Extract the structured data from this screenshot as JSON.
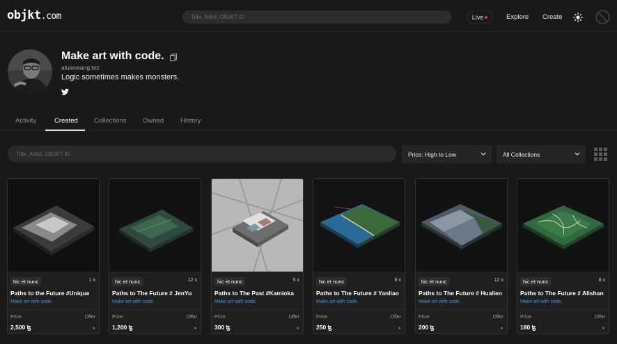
{
  "header": {
    "logo_main": "objkt",
    "logo_suffix": ".com",
    "search_placeholder": "Title, Artist, OBJKT ID",
    "live_label": "Live",
    "explore_label": "Explore",
    "create_label": "Create",
    "theme_icon": "sun-icon",
    "right_icon": "blocked-icon"
  },
  "profile": {
    "name": "Make art with code.",
    "handle": "aluanwang.tez",
    "bio": "Logic sometimes makes monsters.",
    "social_icon": "twitter-icon"
  },
  "tabs": [
    {
      "label": "Activity",
      "active": false
    },
    {
      "label": "Created",
      "active": true
    },
    {
      "label": "Collections",
      "active": false
    },
    {
      "label": "Owned",
      "active": false
    },
    {
      "label": "History",
      "active": false
    }
  ],
  "filters": {
    "search_placeholder": "Title, Artist, OBJKT ID",
    "sort_value": "Price: High to Low",
    "collection_value": "All Collections",
    "view_icon": "grid-view-icon"
  },
  "cards": [
    {
      "platform": "hic et nunc",
      "editions": "1 x",
      "title": "Paths to the Future #Unique",
      "artist": "Make art with code.",
      "price_label": "Price",
      "price": "2,500 ꜩ",
      "offer_label": "Offer",
      "offer": "-"
    },
    {
      "platform": "hic et nunc",
      "editions": "12 x",
      "title": "Paths to The Future  # JenYu",
      "artist": "Make art with code.",
      "price_label": "Price",
      "price": "1,200 ꜩ",
      "offer_label": "Offer",
      "offer": "-"
    },
    {
      "platform": "hic et nunc",
      "editions": "5 x",
      "title": "Paths to The Past #Kamioka",
      "artist": "Make art with code.",
      "price_label": "Price",
      "price": "300 ꜩ",
      "offer_label": "Offer",
      "offer": "-"
    },
    {
      "platform": "hic et nunc",
      "editions": "8 x",
      "title": "Paths to The Future  # Yanliao",
      "artist": "Make art with code.",
      "price_label": "Price",
      "price": "250 ꜩ",
      "offer_label": "Offer",
      "offer": "-"
    },
    {
      "platform": "hic et nunc",
      "editions": "12 x",
      "title": "Paths to The Future  # Hualien",
      "artist": "Make art with code.",
      "price_label": "Price",
      "price": "200 ꜩ",
      "offer_label": "Offer",
      "offer": "-"
    },
    {
      "platform": "hic et nunc",
      "editions": "8 x",
      "title": "Paths to The Future  # Alishan",
      "artist": "Make art with code.",
      "price_label": "Price",
      "price": "180 ꜩ",
      "offer_label": "Offer",
      "offer": "-"
    }
  ],
  "colors": {
    "background": "#191919",
    "link": "#3e95e8",
    "live_dot": "#e03b3b"
  }
}
